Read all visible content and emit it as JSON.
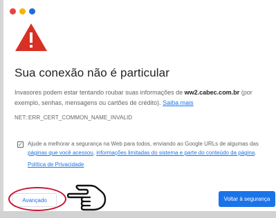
{
  "window": {
    "dots": [
      {
        "icon": "close-dot",
        "color": "#ed4242"
      },
      {
        "icon": "minimize-dot",
        "color": "#f5b400"
      },
      {
        "icon": "maximize-dot",
        "color": "#1e6be0"
      }
    ]
  },
  "warning": {
    "icon": "warning-triangle-icon",
    "color": "#d93025",
    "title": "Sua conexão não é particular"
  },
  "description": {
    "before_domain": "Invasores podem estar tentando roubar suas informações de ",
    "domain": "ww2.cabec.com.br",
    "after_domain": " (por exemplo, senhas, mensagens ou cartões de crédito). ",
    "learn_more": "Saiba mais"
  },
  "error_code": "NET::ERR_CERT_COMMON_NAME_INVALID",
  "extended_reporting": {
    "checked": true,
    "text_before": "Ajude a melhorar a segurança na Web para todos, enviando ao Google URLs de algumas das ",
    "pages_link": "páginas que você acessou",
    "text_middle": ", ",
    "info_link": "informações limitadas do sistema e parte do conteúdo da página",
    "text_after": ".",
    "privacy_link": "Política de Privacidade"
  },
  "buttons": {
    "advanced": "Avançado",
    "back_to_safety": "Voltar à segurança"
  },
  "annotation": {
    "highlight_color": "#c8102e",
    "pointer_icon": "pointing-hand-icon"
  }
}
